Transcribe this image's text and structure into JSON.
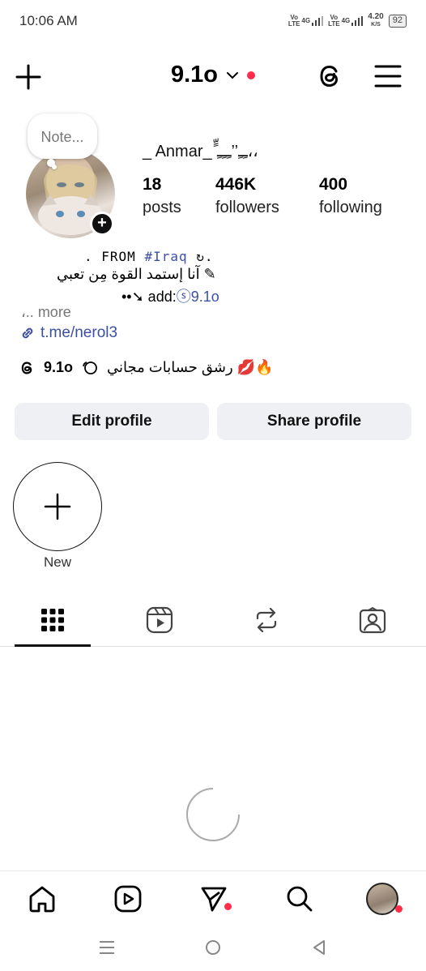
{
  "status_bar": {
    "time": "10:06 AM",
    "sim1_label_top": "Vo",
    "sim1_label_bottom": "LTE",
    "sim1_net": "4G",
    "sim2_label_top": "Vo",
    "sim2_label_bottom": "LTE",
    "sim2_net": "4G",
    "speed_value": "4.20",
    "speed_unit": "K/S",
    "battery": "92"
  },
  "header": {
    "username": "9.1o",
    "icons": [
      "plus-icon",
      "chevron-down-icon",
      "threads-icon",
      "menu-icon"
    ],
    "notification_color": "#ff2d4a"
  },
  "profile": {
    "note_placeholder": "Note...",
    "display_name": "_ Anmar_ ٍّﹻﹻ’’ﹻﹻﹻ،،",
    "stats": [
      {
        "value": "18",
        "label": "posts"
      },
      {
        "value": "446K",
        "label": "followers"
      },
      {
        "value": "400",
        "label": "following"
      }
    ],
    "bio_line1_prefix": ". FROM ",
    "bio_line1_tag": "#Iraq",
    "bio_line1_suffix": " ↻.",
    "bio_line2": "آنا إستمد القوة مِن تعبي ✎",
    "bio_line3_prefix": "••➘ add:",
    "bio_line3_handle": "9.1o",
    "more_label": "،.. more",
    "link": "t.me/nerol3",
    "threads_handle": "9.1o",
    "threads_bio": "رشق حسابات مجاني 💋🔥"
  },
  "actions": {
    "edit_profile": "Edit profile",
    "share_profile": "Share profile"
  },
  "highlights": {
    "new_label": "New"
  },
  "tabs": [
    "grid-icon",
    "reels-icon",
    "reposts-icon",
    "tagged-icon"
  ],
  "bottom_nav": [
    "home-icon",
    "reels-icon",
    "direct-icon",
    "search-icon",
    "profile-avatar"
  ],
  "accent_color": "#3b4fa8"
}
